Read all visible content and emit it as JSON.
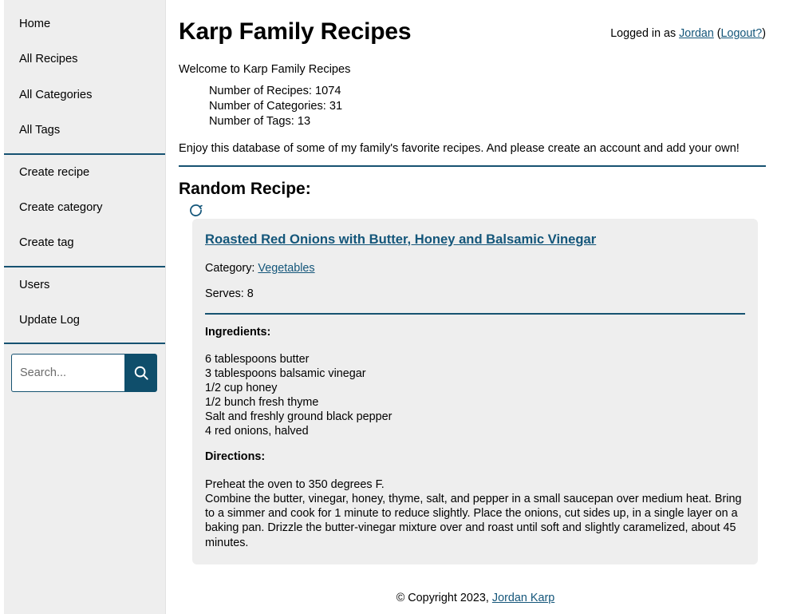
{
  "sidebar": {
    "groups": [
      {
        "name": "browse",
        "items": [
          {
            "label": "Home",
            "name": "sidebar-item-home"
          },
          {
            "label": "All Recipes",
            "name": "sidebar-item-all-recipes"
          },
          {
            "label": "All Categories",
            "name": "sidebar-item-all-categories"
          },
          {
            "label": "All Tags",
            "name": "sidebar-item-all-tags"
          }
        ]
      },
      {
        "name": "create",
        "items": [
          {
            "label": "Create recipe",
            "name": "sidebar-item-create-recipe"
          },
          {
            "label": "Create category",
            "name": "sidebar-item-create-category"
          },
          {
            "label": "Create tag",
            "name": "sidebar-item-create-tag"
          }
        ]
      },
      {
        "name": "admin",
        "items": [
          {
            "label": "Users",
            "name": "sidebar-item-users"
          },
          {
            "label": "Update Log",
            "name": "sidebar-item-update-log"
          }
        ]
      }
    ],
    "search": {
      "placeholder": "Search...",
      "value": "",
      "button_icon": "search-icon"
    }
  },
  "header": {
    "title": "Karp Family Recipes",
    "login_prefix": "Logged in as ",
    "user": "Jordan",
    "paren_open": " (",
    "logout": "Logout?",
    "paren_close": ")"
  },
  "intro": {
    "welcome": "Welcome to Karp Family Recipes",
    "stats": [
      "Number of Recipes: 1074",
      "Number of Categories: 31",
      "Number of Tags: 13"
    ],
    "tagline": "Enjoy this database of some of my family's favorite recipes. And please create an account and add your own!"
  },
  "random_recipe": {
    "section_heading": "Random Recipe:",
    "refresh_icon": "refresh-icon",
    "title": "Roasted Red Onions with Butter, Honey and Balsamic Vinegar",
    "category_label": "Category: ",
    "category_value": "Vegetables",
    "serves_label": "Serves: 8",
    "ingredients_heading": "Ingredients:",
    "ingredients": [
      "6 tablespoons butter",
      "3 tablespoons balsamic vinegar",
      "1/2 cup honey",
      "1/2 bunch fresh thyme",
      "Salt and freshly ground black pepper",
      "4 red onions, halved"
    ],
    "directions_heading": "Directions:",
    "directions_line1": "Preheat the oven to 350 degrees F.",
    "directions_line2": "Combine the butter, vinegar, honey, thyme, salt, and pepper in a small saucepan over medium heat. Bring to a simmer and cook for 1 minute to reduce slightly. Place the onions, cut sides up, in a single layer on a baking pan. Drizzle the butter-vinegar mixture over and roast until soft and slightly caramelized, about 45 minutes."
  },
  "footer": {
    "copyright": "© Copyright 2023, ",
    "author": "Jordan Karp"
  },
  "colors": {
    "accent": "#165271",
    "link": "#14567a",
    "sidebar_bg": "#eeeeee",
    "card_bg": "#eeeeee",
    "button_bg": "#0f4e6b",
    "page_bg": "#ffffff"
  }
}
